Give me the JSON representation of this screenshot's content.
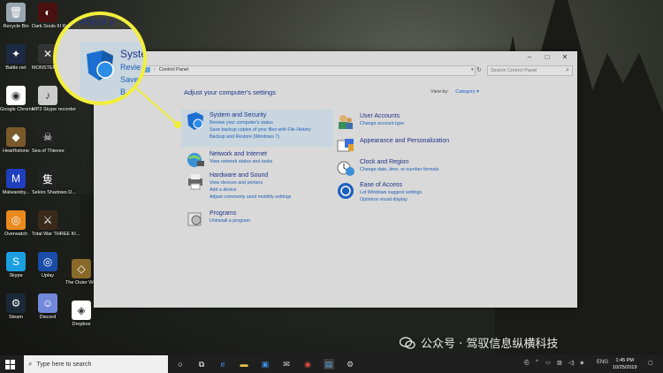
{
  "desktop_icons": [
    {
      "label": "Recycle Bin",
      "color": "#9aa6b2",
      "glyph": "🗑"
    },
    {
      "label": "Battle.net",
      "color": "#1c2a44",
      "glyph": "✦"
    },
    {
      "label": "Google Chrome",
      "color": "#ffffff",
      "glyph": "◉"
    },
    {
      "label": "Hearthstone",
      "color": "#7a5a2a",
      "glyph": "◆"
    },
    {
      "label": "Malwareby...",
      "color": "#1f3fbf",
      "glyph": "M"
    },
    {
      "label": "Overwatch",
      "color": "#ea8a1e",
      "glyph": "◎"
    },
    {
      "label": "Skype",
      "color": "#1a9fe0",
      "glyph": "S"
    },
    {
      "label": "Steam",
      "color": "#1b2838",
      "glyph": "⚙"
    },
    {
      "label": "Dark Souls III Remastered",
      "color": "#4a1010",
      "glyph": "◐"
    },
    {
      "label": "MONSTER HUNTER",
      "color": "#333333",
      "glyph": "✕"
    },
    {
      "label": "MP3 Skype recorder",
      "color": "#cccccc",
      "glyph": "♪"
    },
    {
      "label": "Sea of Thieves",
      "color": "#222222",
      "glyph": "☠"
    },
    {
      "label": "Sekiro Shadows D...",
      "color": "#222222",
      "glyph": "隻"
    },
    {
      "label": "Total War THREE KI...",
      "color": "#3a2a1a",
      "glyph": "⚔"
    },
    {
      "label": "Uplay",
      "color": "#1a4ca8",
      "glyph": "◎"
    },
    {
      "label": "Discord",
      "color": "#7289da",
      "glyph": "☺"
    },
    {
      "label": "The Outer Worlds",
      "color": "#8a6a2a",
      "glyph": "◇"
    },
    {
      "label": "Dropbox",
      "color": "#ffffff",
      "glyph": "◈"
    }
  ],
  "window": {
    "breadcrumb": "Control Panel",
    "search_placeholder": "Search Control Panel",
    "heading": "Adjust your computer's settings",
    "view_by_label": "View by:",
    "view_by_value": "Category ▾",
    "categories_left": [
      {
        "title": "System and Security",
        "links": [
          "Review your computer's status",
          "Save backup copies of your files with File History",
          "Backup and Restore (Windows 7)"
        ],
        "icon": "shield"
      },
      {
        "title": "Network and Internet",
        "links": [
          "View network status and tasks"
        ],
        "icon": "globe"
      },
      {
        "title": "Hardware and Sound",
        "links": [
          "View devices and printers",
          "Add a device",
          "Adjust commonly used mobility settings"
        ],
        "icon": "printer"
      },
      {
        "title": "Programs",
        "links": [
          "Uninstall a program"
        ],
        "icon": "programs"
      }
    ],
    "categories_right": [
      {
        "title": "User Accounts",
        "links": [
          "Change account type"
        ],
        "icon": "users"
      },
      {
        "title": "Appearance and Personalization",
        "links": [],
        "icon": "appearance"
      },
      {
        "title": "Clock and Region",
        "links": [
          "Change date, time, or number formats"
        ],
        "icon": "clock"
      },
      {
        "title": "Ease of Access",
        "links": [
          "Let Windows suggest settings",
          "Optimize visual display"
        ],
        "icon": "ease"
      }
    ]
  },
  "callout": {
    "heading_fragment": "Adjust y",
    "title_fragment": "Syste",
    "line1": "Revie",
    "line2": "Save",
    "line3": "B",
    "accent": "#f2ef3a"
  },
  "taskbar": {
    "search_placeholder": "Type here to search",
    "language": "ENG",
    "time": "1:45 PM",
    "date": "10/25/2019"
  },
  "watermark": "公众号 · 驾驭信息纵横科技"
}
